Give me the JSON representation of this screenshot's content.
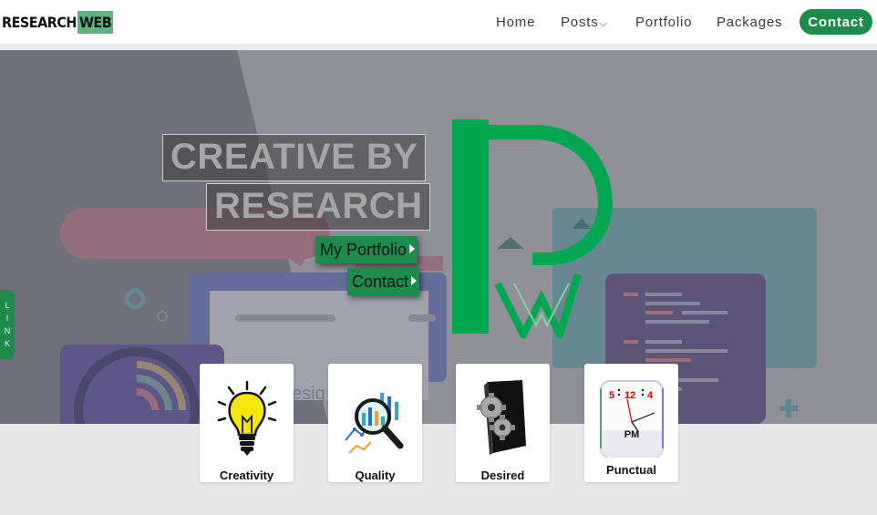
{
  "header": {
    "logo_part1": "RESEARCH",
    "logo_part2": "WEB",
    "nav": {
      "home": "Home",
      "posts": "Posts",
      "portfolio": "Portfolio",
      "packages": "Packages",
      "contact": "Contact"
    }
  },
  "hero": {
    "headline_line1": "CREATIVE BY",
    "headline_line2": "RESEARCH",
    "cta_portfolio": "My Portfolio",
    "cta_contact": "Contact",
    "side_link_letters": [
      "L",
      "I",
      "N",
      "K"
    ]
  },
  "features": [
    {
      "label": "Creativity",
      "icon": "lightbulb-icon"
    },
    {
      "label": "Quality",
      "icon": "analytics-magnifier-icon"
    },
    {
      "label": "Desired",
      "icon": "gears-icon"
    },
    {
      "label": "Punctual",
      "icon": "clock-icon"
    }
  ],
  "clock": {
    "digits": [
      "5",
      "12",
      "4"
    ],
    "period": "PM"
  },
  "colors": {
    "brand_green": "#1e8a4c",
    "logo_green": "#00a650",
    "logo_web_bg": "#5fb380"
  }
}
